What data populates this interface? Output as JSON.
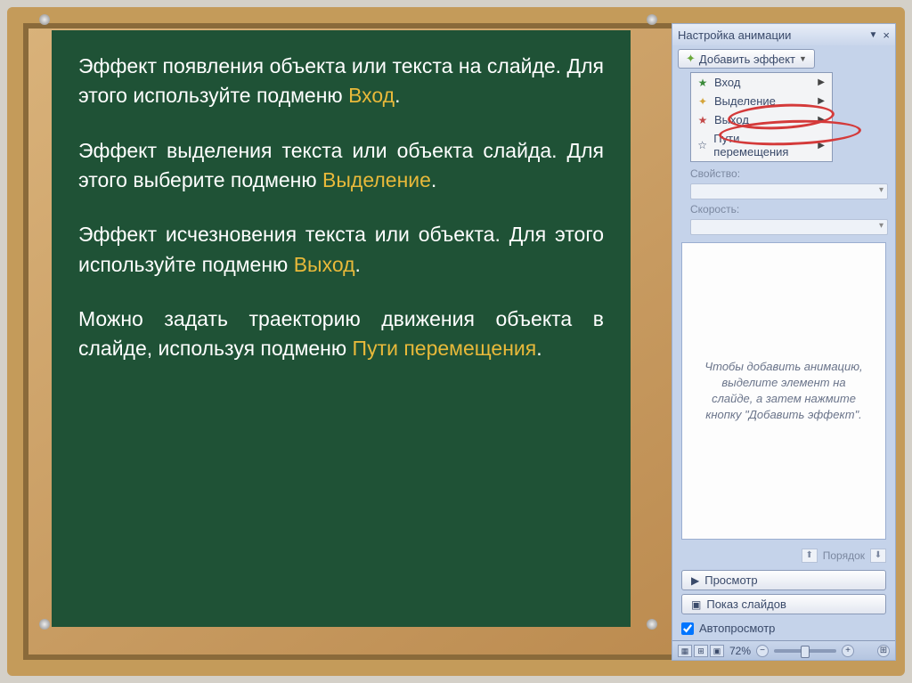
{
  "slide": {
    "para1_pre": "Эффект появления объекта или текста на слайде. Для этого используйте подменю ",
    "para1_hl": "Вход",
    "para1_post": ".",
    "para2_pre": "Эффект выделения текста или объекта слайда. Для этого выберите подменю ",
    "para2_hl": "Выделение",
    "para2_post": ".",
    "para3_pre": "Эффект исчезновения текста или объекта. Для этого используйте подменю ",
    "para3_hl": "Выход",
    "para3_post": ".",
    "para4_pre": "Можно задать траекторию движения объекта в слайде, используя подменю ",
    "para4_hl": "Пути перемещения",
    "para4_post": "."
  },
  "panel": {
    "title": "Настройка анимации",
    "add_effect": "Добавить эффект",
    "menu": {
      "item1": "Вход",
      "item2": "Выделение",
      "item3": "Выход",
      "item4": "Пути перемещения"
    },
    "property": "Свойство:",
    "speed": "Скорость:",
    "hint": "Чтобы добавить анимацию, выделите элемент на слайде, а затем нажмите кнопку \"Добавить эффект\".",
    "order": "Порядок",
    "preview": "Просмотр",
    "slideshow": "Показ слайдов",
    "autopreview": "Автопросмотр"
  },
  "statusbar": {
    "zoom": "72%",
    "minus": "−",
    "plus": "+",
    "fit": "⊞"
  }
}
